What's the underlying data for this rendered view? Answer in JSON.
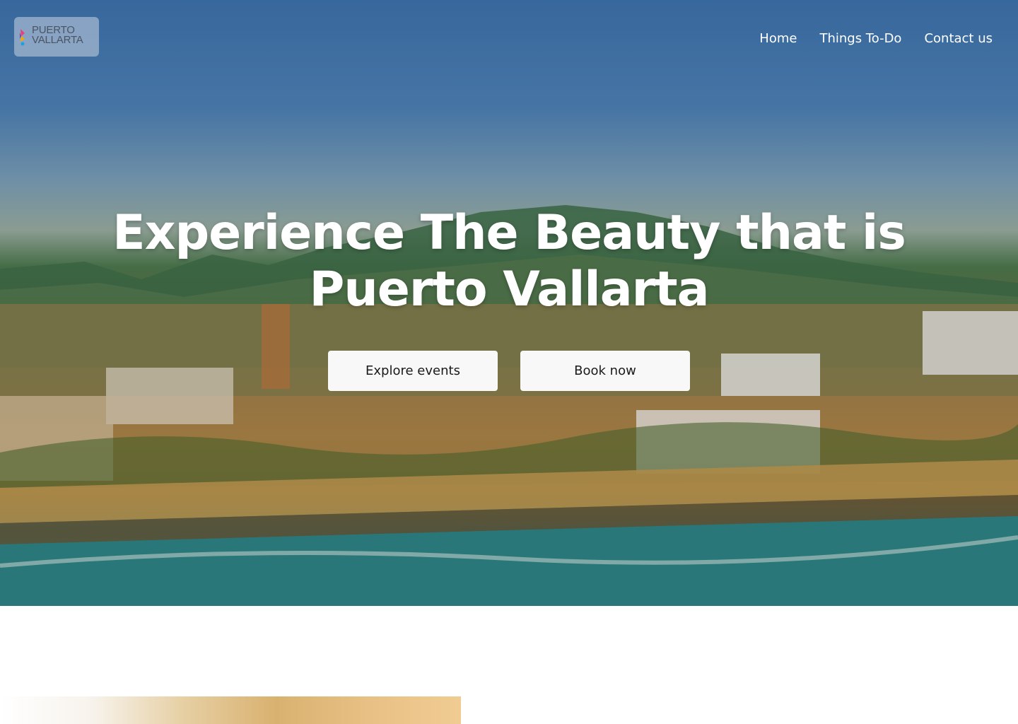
{
  "logo": {
    "text": "PUERTO\nVALLARTA"
  },
  "nav": {
    "items": [
      "Home",
      "Things To-Do",
      "Contact us"
    ]
  },
  "hero": {
    "headline": "Experience The Beauty that is Puerto Vallarta",
    "buttons": {
      "explore": "Explore events",
      "book": "Book now"
    }
  },
  "colors": {
    "nav_text": "#ffffff",
    "button_bg": "#f8f8f8",
    "button_text": "#1a1a1a"
  }
}
